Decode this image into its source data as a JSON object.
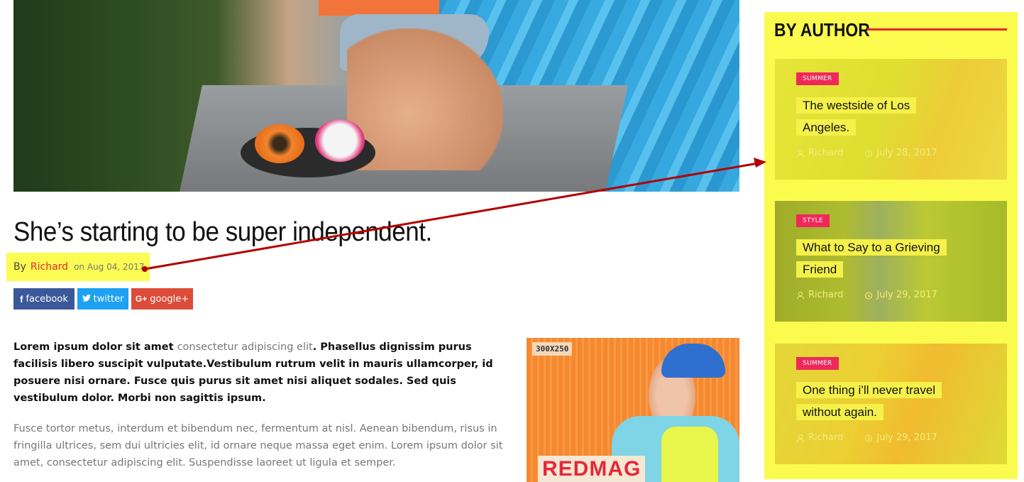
{
  "article": {
    "title": "She’s starting to be super independent.",
    "byline": {
      "by_label": "By",
      "author": "Richard",
      "date_text": "on Aug 04, 2017"
    },
    "share": {
      "facebook": "facebook",
      "twitter": "twitter",
      "google": "google+"
    },
    "para1_lead": "Lorem ipsum dolor sit amet ",
    "para1_link": "consectetur adipiscing elit",
    "para1_rest": ". Phasellus dignissim purus facilisis libero suscipit vulputate.Vestibulum rutrum velit in mauris ullamcorper, id posuere nisi ornare. Fusce quis purus sit amet nisi aliquet sodales. Sed quis vestibulum dolor. Morbi non sagittis ipsum.",
    "para2": "Fusce tortor metus, interdum et bibendum nec, fermentum at nisl. Aenean bibendum, risus in fringilla ultrices, sem dui ultricies elit, id ornare neque massa eget enim. Lorem ipsum dolor sit amet, consectetur adipiscing elit. Suspendisse laoreet ut ligula et semper."
  },
  "ad": {
    "size_label": "300X250",
    "brand": "REDMAG"
  },
  "sidebar": {
    "widget_title": "BY AUTHOR",
    "posts": [
      {
        "category": "SUMMER",
        "title": "The westside of Los Angeles.",
        "author": "Richard",
        "date": "July 28, 2017"
      },
      {
        "category": "STYLE",
        "title": "What to Say to a Grieving Friend",
        "author": "Richard",
        "date": "July 29, 2017"
      },
      {
        "category": "SUMMER",
        "title": "One thing i’ll never travel without again.",
        "author": "Richard",
        "date": "July 29, 2017"
      }
    ]
  },
  "colors": {
    "highlight": "#fcfc52",
    "accent_red": "#e6282e",
    "category_badge": "#f0285a",
    "facebook": "#3b5998",
    "twitter": "#1da1f2",
    "google": "#dd4b39",
    "annotation_arrow": "#b30000"
  }
}
